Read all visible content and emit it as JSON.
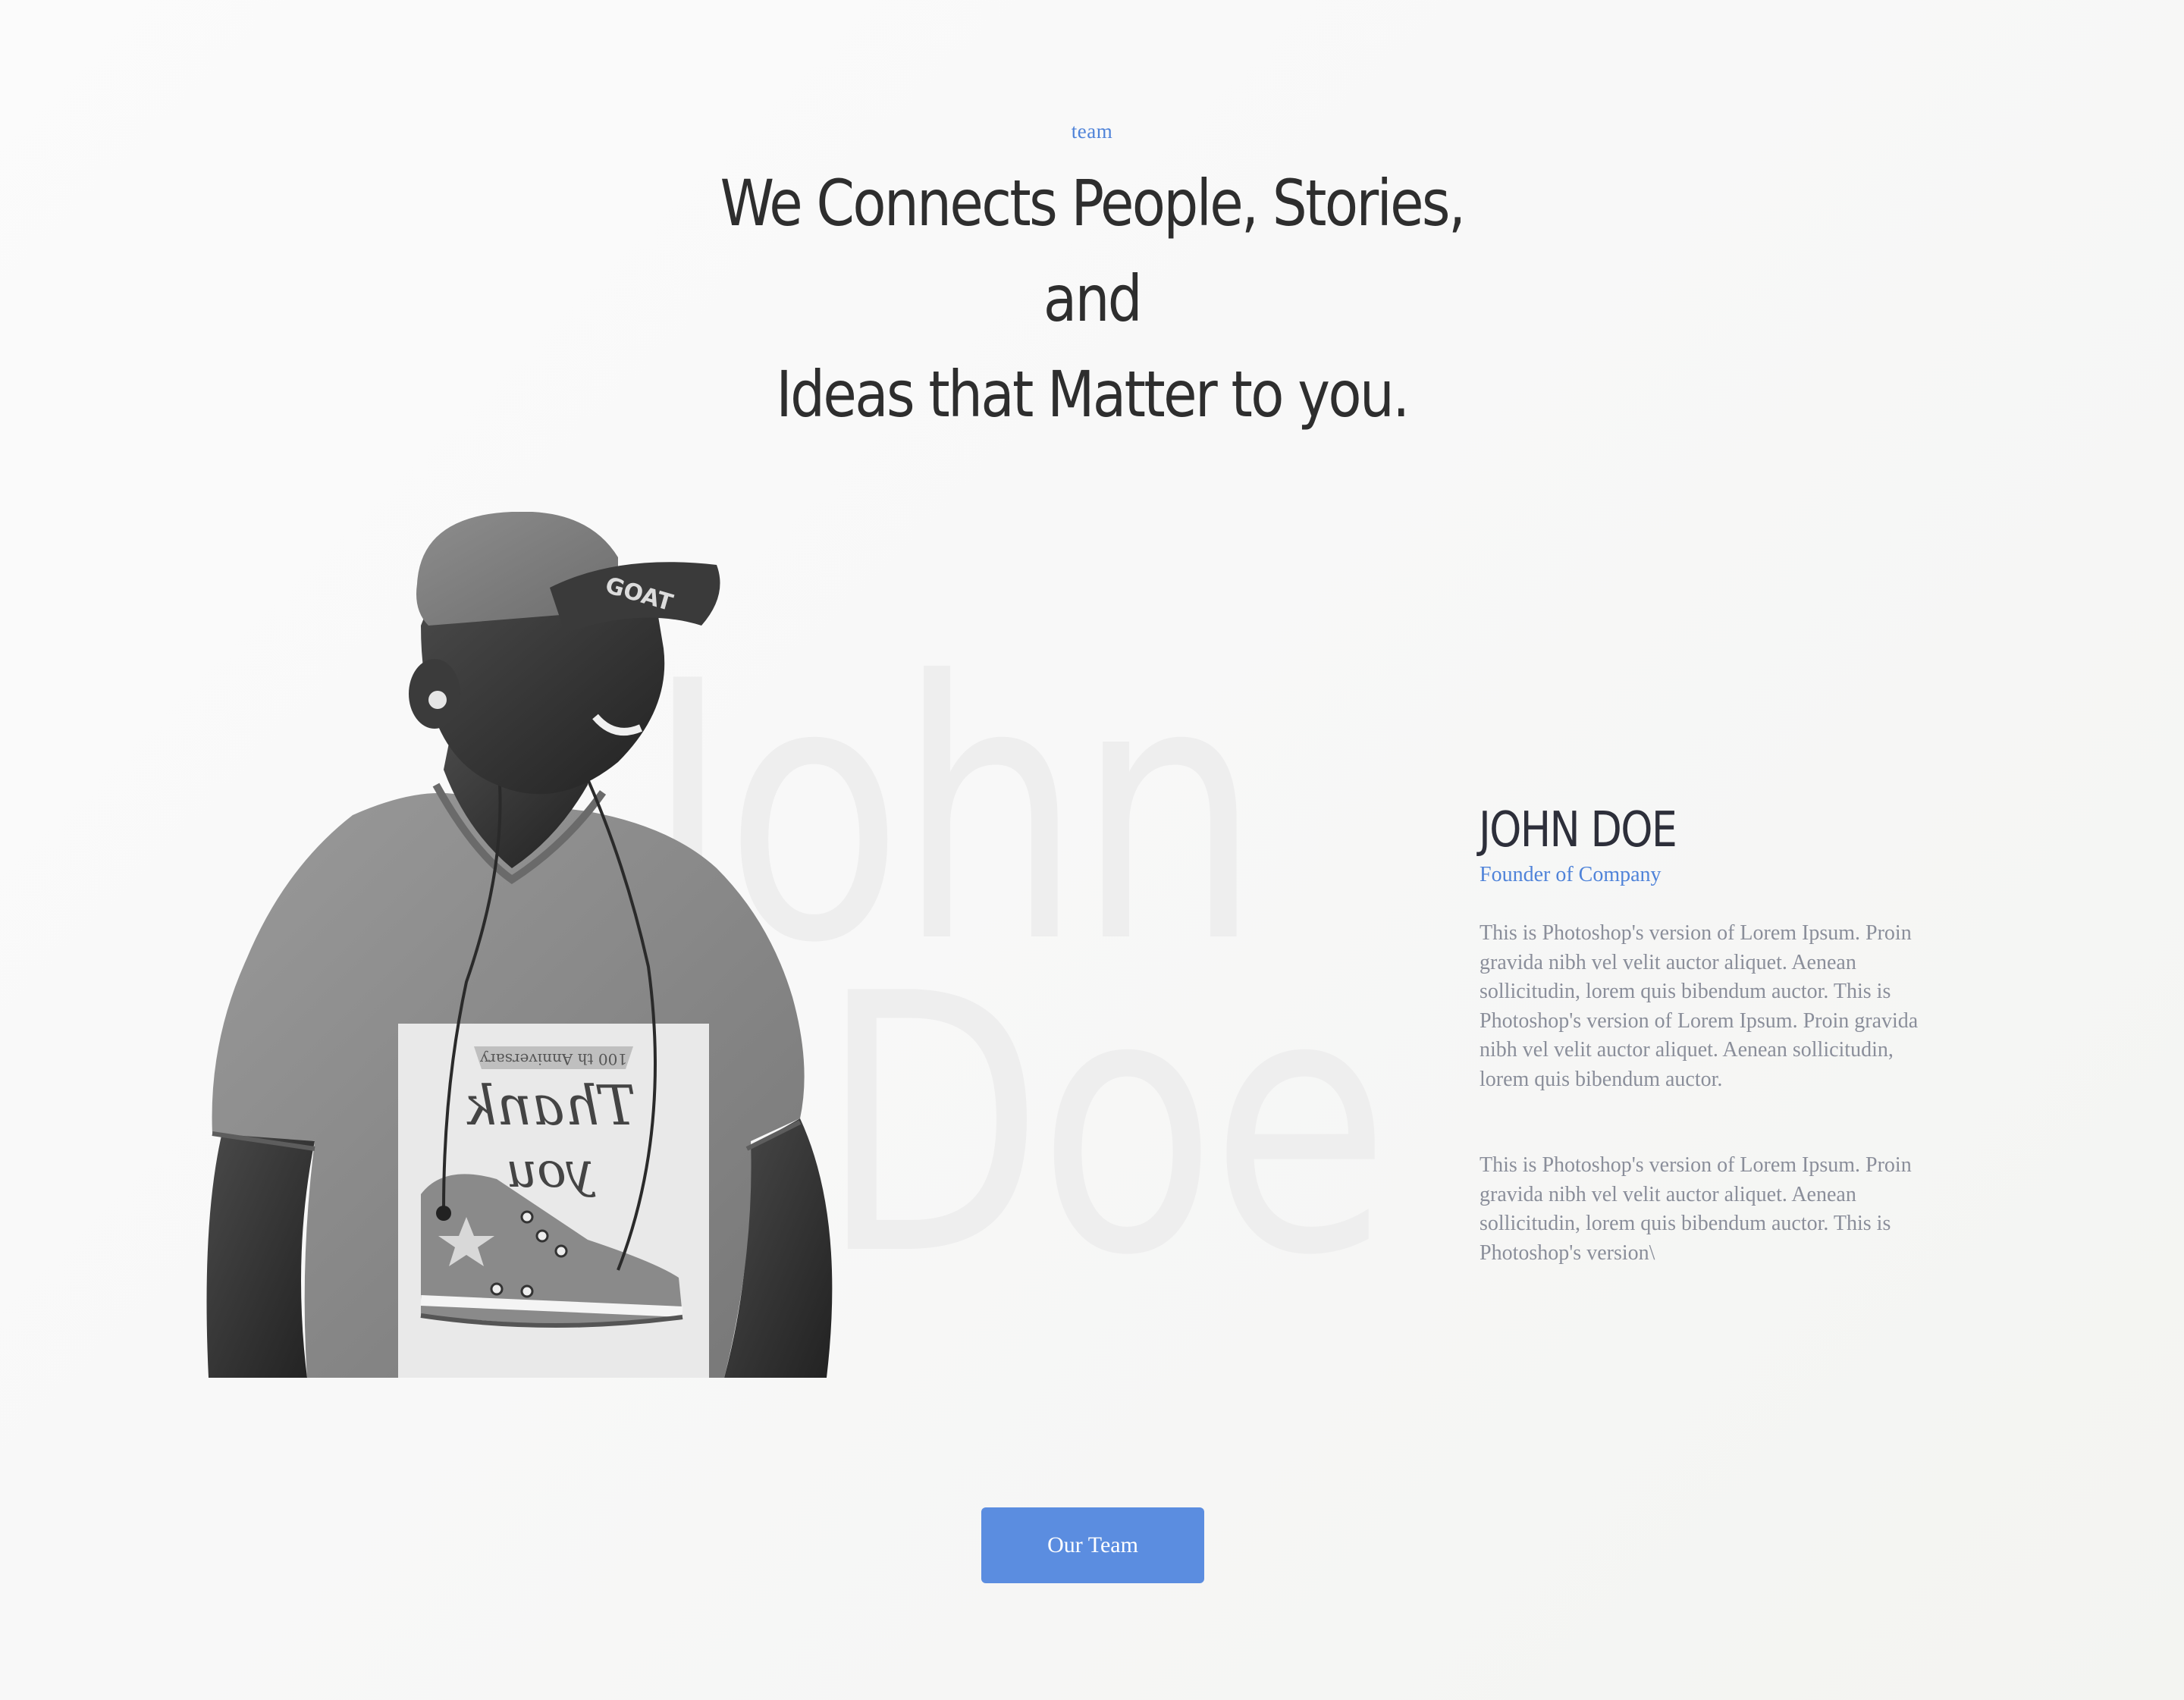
{
  "header": {
    "eyebrow": "team",
    "headline_line1": "We Connects People, Stories, and",
    "headline_line2": "Ideas that Matter to you."
  },
  "watermark": {
    "first": "John",
    "last": "Doe"
  },
  "profile": {
    "name": "JOHN DOE",
    "role": "Founder of Company",
    "bio_paragraphs": [
      "This is Photoshop's version  of Lorem Ipsum. Proin gravida nibh vel velit auctor aliquet. Aenean sollicitudin, lorem quis bibendum auctor. This is Photoshop's version  of Lorem Ipsum. Proin gravida nibh vel velit auctor aliquet. Aenean sollicitudin, lorem quis bibendum auctor.",
      "This is Photoshop's version  of Lorem Ipsum. Proin gravida nibh vel velit auctor aliquet. Aenean sollicitudin, lorem quis bibendum auctor. This is Photoshop's version\\"
    ],
    "photo_tshirt": {
      "banner": "100 th Anniversary",
      "word1": "Thank",
      "word2": "you"
    }
  },
  "cta": {
    "label": "Our Team"
  },
  "colors": {
    "accent": "#4f83d9",
    "button": "#5b8de0",
    "heading": "#2e2e2e",
    "body_text": "#8a8e9a",
    "watermark": "#eeeeee"
  }
}
